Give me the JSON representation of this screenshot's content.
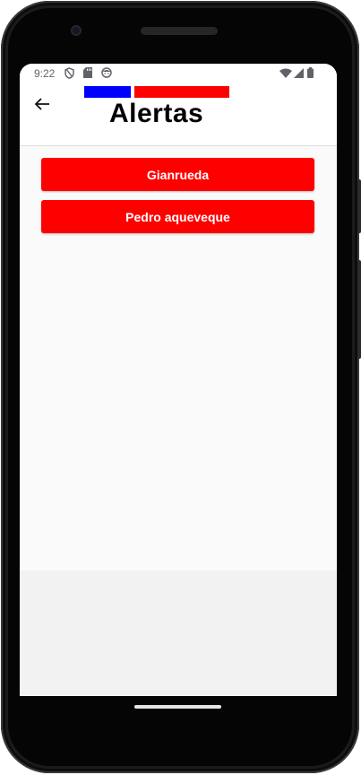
{
  "status_bar": {
    "time": "9:22",
    "left_icons": [
      "shield-icon",
      "sd-card-icon",
      "face-icon"
    ],
    "right_icons": [
      "wifi-icon",
      "signal-icon",
      "battery-icon"
    ]
  },
  "app_bar": {
    "title": "Alertas",
    "back_icon": "arrow-left-icon",
    "flag_colors": [
      "#0000ff",
      "#ff0000"
    ]
  },
  "alerts": [
    {
      "label": "Gianrueda"
    },
    {
      "label": "Pedro aqueveque"
    }
  ],
  "colors": {
    "button_bg": "#ff0000",
    "button_text": "#ffffff",
    "content_bg": "#fafafa"
  }
}
